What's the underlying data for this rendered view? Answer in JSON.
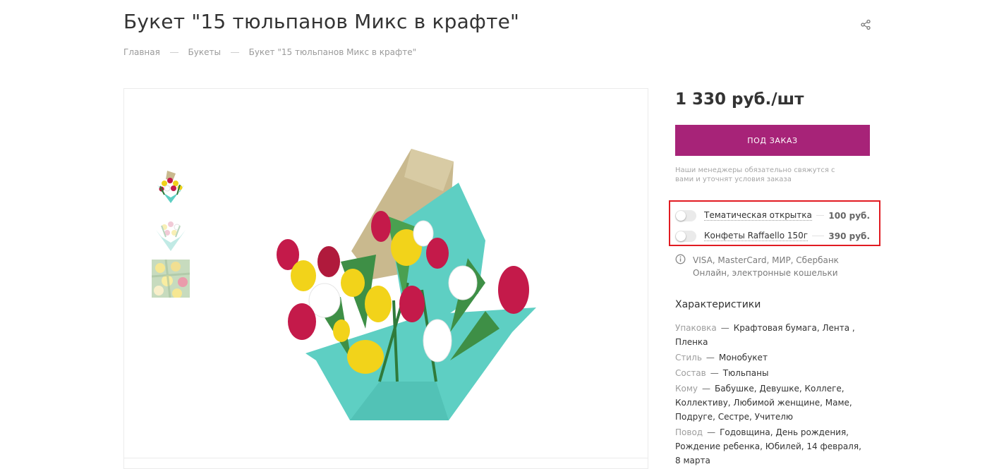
{
  "product": {
    "title": "Букет \"15 тюльпанов Микс в крафте\"",
    "price": "1 330 руб./шт",
    "order_button": "ПОД ЗАКАЗ",
    "order_note": "Наши менеджеры обязательно свяжутся с вами и уточнят условия заказа"
  },
  "breadcrumbs": [
    {
      "label": "Главная"
    },
    {
      "label": "Букеты"
    },
    {
      "label": "Букет \"15 тюльпанов Микс в крафте\""
    }
  ],
  "addons": [
    {
      "label": "Тематическая открытка",
      "price": "100 руб.",
      "enabled": false
    },
    {
      "label": "Конфеты Raffaello 150г",
      "price": "390 руб.",
      "enabled": false
    }
  ],
  "payment": {
    "icon": "info-icon",
    "text": "VISA, MasterCard, МИР, Сбербанк Онлайн, электронные кошельки"
  },
  "characteristics": {
    "title": "Характеристики",
    "items": [
      {
        "key": "Упаковка",
        "value": "Крафтовая бумага, Лента , Пленка"
      },
      {
        "key": "Стиль",
        "value": "Монобукет"
      },
      {
        "key": "Состав",
        "value": "Тюльпаны"
      },
      {
        "key": "Кому",
        "value": "Бабушке, Девушке, Коллеге, Коллективу, Любимой женщине, Маме, Подруге, Сестре, Учителю"
      },
      {
        "key": "Повод",
        "value": "Годовщина, День рождения, Рождение ребенка, Юбилей, 14 февраля, 8 марта"
      }
    ]
  },
  "colors": {
    "accent": "#a72378",
    "highlight_box": "#e11b22",
    "wrap_teal": "#5ecfc3",
    "wrap_kraft": "#c9b98e"
  },
  "icons": {
    "share": "share-icon",
    "info": "info-icon"
  }
}
